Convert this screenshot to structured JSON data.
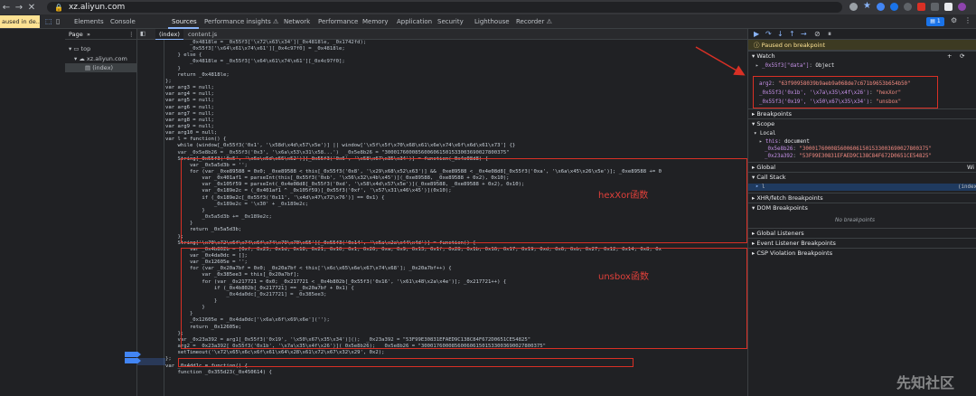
{
  "browser": {
    "url": "xz.aliyun.com"
  },
  "paused_pill": "aused in de...",
  "devtools_tabs": [
    "Elements",
    "Console",
    "Sources",
    "Performance insights ⚠",
    "Network",
    "Performance",
    "Memory",
    "Application",
    "Security",
    "Lighthouse",
    "Recorder ⚠"
  ],
  "issues_count": "1",
  "navigator": {
    "tab_page": "Page",
    "more": "»",
    "items": [
      "top",
      "xz.aliyun.com",
      "(index)"
    ]
  },
  "editor_tabs": [
    "(index)",
    "content.js"
  ],
  "code_lines": [
    "        _0x4818le = _0x55f3['\\x72\\x63\\x34'](_0x4818le, _0x1742fd);",
    "        _0x55f3['\\x64\\x61\\x74\\x61'][_0x4c97f0] = _0x4818le;",
    "    } else {",
    "        _0x4818le = _0x55f3['\\x64\\x61\\x74\\x61'][_0x4c97f0];",
    "    }",
    "    return _0x4818le;",
    "};",
    "var arg3 = null;",
    "var arg4 = null;",
    "var arg5 = null;",
    "var arg6 = null;",
    "var arg7 = null;",
    "var arg8 = null;",
    "var arg9 = null;",
    "var arg10 = null;",
    "var l = function() {",
    "    while (window[_0x55f3('0x1', '\\x58d\\x4d\\x57\\x5e')] || window['\\x5f\\x5f\\x70\\x68\\x61\\x6e\\x74\\x6f\\x6d\\x61\\x73'] {}",
    "    var _0x5e8b26 = _0x55f3('0x3', '\\x6a\\x53\\x31\\x58...')  _0x5e8b26 = \"3000176000856006061501533003690027800375\"",
    "    String[_0x55f3('0x5', '\\x6e\\x5d\\x66\\x52')][_0x55f3('0x6', '\\x58\\x67\\x35\\x34')] = function(_0x4e08d8) {",
    "        var _0x5a5d3b = '';",
    "        for (var _0xe89588 = 0x0; _0xe89588 < this[_0x55f3('0x8', '\\x29\\x68\\x52\\x63')] && _0xe89588 < _0x4e08d8[_0x55f3('0xa', '\\x6a\\x45\\x26\\x5e')]; _0xe89588 += 0",
    "            var _0x401af1 = parseInt(this[_0x55f3('0xb', '\\x56\\x32\\x4b\\x45')](_0xe89588, _0xe89588 + 0x2), 0x10);",
    "            var _0x105f59 = parseInt(_0x4e08d8[_0x55f3('0xd', '\\x58\\x4d\\x57\\x5e')](_0xe89588, _0xe89588 + 0x2), 0x10);",
    "            var _0x189e2c = (_0x401af1 ^ _0x105f59)[_0x55f3('0xf', '\\x57\\x31\\x46\\x45')](0x10);",
    "            if (_0x189e2c[_0x55f3('0x11', '\\x4d\\x47\\x72\\x76')] == 0x1) {",
    "                _0x189e2c = '\\x30' + _0x189e2c;",
    "            }",
    "            _0x5a5d3b += _0x189e2c;",
    "        }",
    "        return _0x5a5d3b;",
    "    };",
    "    String['\\x70\\x72\\x6f\\x74\\x6f\\x74\\x79\\x70\\x65'][_0x55f3('0x14', '\\x5a\\x2a\\x44\\x4d')] = function() {",
    "        var _0x4b802b = [0xf, 0x23, 0x1d, 0x18, 0x21, 0x10, 0x1, 0x26, 0xa, 0x9, 0x13, 0x1f, 0x28, 0x1b, 0x16, 0x17, 0x19, 0xd, 0x6, 0xb, 0x27, 0x12, 0x14, 0x8, 0x",
    "        var _0x4da0dc = [];",
    "        var _0x12605e = '';",
    "        for (var _0x20a7bf = 0x0; _0x20a7bf < this['\\x6c\\x65\\x6e\\x67\\x74\\x68']; _0x20a7bf++) {",
    "            var _0x385ee3 = this[_0x20a7bf];",
    "            for (var _0x217721 = 0x0; _0x217721 < _0x4b802b[_0x55f3('0x16', '\\x61\\x48\\x2a\\x4e')]; _0x217721++) {",
    "                if (_0x4b802b[_0x217721] == _0x20a7bf + 0x1) {",
    "                    _0x4da0dc[_0x217721] = _0x385ee3;",
    "                }",
    "            }",
    "        }",
    "        _0x12605e = _0x4da0dc['\\x6a\\x6f\\x69\\x6e']('');",
    "        return _0x12605e;",
    "    };",
    "    var _0x23a392 = arg1[_0x55f3('0x19', '\\x50\\x67\\x35\\x34')]();  _0x23a392 = \"53F99E30831EFAED9C138C84F672D0651CE54825\"",
    "    arg2 = _0x23a392[_0x55f3('0x1b', '\\x7a\\x35\\x4f\\x26')](_0x5e8b26);  _0x5e8b26 = \"3000176000856006061501533003690027800375\"",
    "    setTimeout('\\x72\\x65\\x6c\\x6f\\x61\\x64\\x28\\x61\\x72\\x67\\x32\\x29', 0x2);",
    "};",
    "var _0x4dd1c = function() {",
    "    function _0x355d23(_0x450614) {"
  ],
  "annotations": {
    "hexxor": "hexXor函数",
    "unsbox": "unsbox函数"
  },
  "debugger": {
    "paused_text": "Paused on breakpoint",
    "watch_title": "Watch",
    "watch_items": [
      {
        "name": "_0x55f3[\"data\"]",
        "value": "Object"
      },
      {
        "name": "arg2",
        "value": "\"63f90958039b9aeb9a068de7c671b9653b654b50\""
      },
      {
        "name": "_0x55f3('0x1b', '\\x7a\\x35\\x4f\\x26')",
        "value": "\"hexXor\""
      },
      {
        "name": "_0x55f3('0x19', '\\x50\\x67\\x35\\x34')",
        "value": "\"unsbox\""
      }
    ],
    "sections": [
      "Breakpoints",
      "Scope",
      "Global",
      "Call Stack",
      "XHR/fetch Breakpoints",
      "DOM Breakpoints",
      "Global Listeners",
      "Event Listener Breakpoints",
      "CSP Violation Breakpoints"
    ],
    "scope_local": "Local",
    "scope_items": [
      {
        "name": "this",
        "value": "document"
      },
      {
        "name": "_0x5e8b26",
        "value": "\"3000176000856006061501533003690027800375\""
      },
      {
        "name": "_0x23a392",
        "value": "\"53F99E30831EFAED9C138C84F672D0651CE54825\""
      }
    ],
    "global_suffix": "Wi",
    "callstack_item": "l",
    "callstack_file": "(index",
    "no_breakpoints": "No breakpoints"
  },
  "watermark": "先知社区",
  "colors": {
    "annotation_red": "#d93025",
    "accent_blue": "#8ab4f8"
  }
}
